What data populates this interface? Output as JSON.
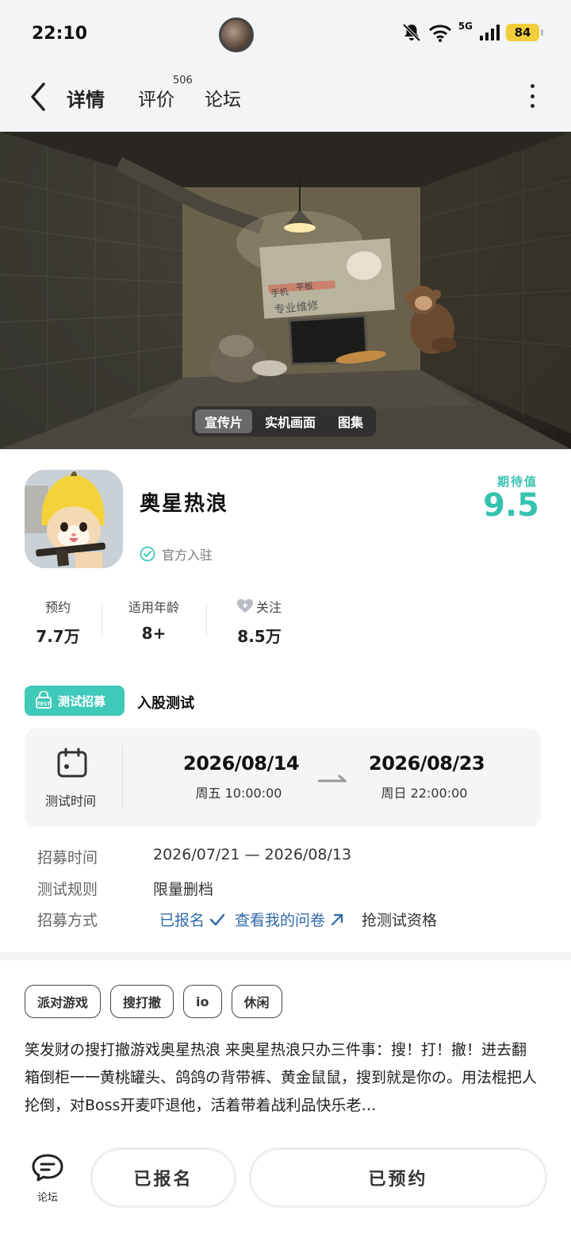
{
  "status": {
    "time": "22:10",
    "network": "5G",
    "wifi_sub": "6",
    "battery": "84"
  },
  "nav": {
    "tabs": [
      {
        "label": "详情"
      },
      {
        "label": "评价",
        "count": "506"
      },
      {
        "label": "论坛"
      }
    ]
  },
  "media": {
    "tabs": [
      "宣传片",
      "实机画面",
      "图集"
    ],
    "poster_text": [
      "手机",
      "平板",
      "专业维修"
    ]
  },
  "app": {
    "name": "奥星热浪",
    "official": "官方入驻",
    "expect_label": "期待值",
    "expect_score": "9.5"
  },
  "stats": [
    {
      "label": "预约",
      "value": "7.7万"
    },
    {
      "label": "适用年龄",
      "value": "8+"
    },
    {
      "label": "关注",
      "value": "8.5万"
    }
  ],
  "recruit": {
    "badge": "测试招募",
    "title": "入股测试",
    "test_time_label": "测试时间",
    "start_date": "2026/08/14",
    "start_sub": "周五  10:00:00",
    "end_date": "2026/08/23",
    "end_sub": "周日  22:00:00",
    "rows": [
      {
        "key": "招募时间",
        "value": "2026/07/21 — 2026/08/13"
      },
      {
        "key": "测试规则",
        "value": "限量删档"
      },
      {
        "key": "招募方式"
      }
    ],
    "signed_up": "已报名",
    "questionnaire": "查看我的问卷",
    "grab": "抢测试资格"
  },
  "tags": [
    "派对游戏",
    "搜打撤",
    "io",
    "休闲"
  ],
  "description": "笑发财の搜打撤游戏奥星热浪 来奥星热浪只办三件事：搜！打！撤！进去翻箱倒柜一一黄桃罐头、鸽鸽の背带裤、黄金鼠鼠，搜到就是你の。用法棍把人抡倒，对Boss开麦吓退他，活着带着战利品快乐老…",
  "bottom": {
    "forum": "论坛",
    "signed_up": "已报名",
    "reserved": "已预约"
  },
  "colors": {
    "accent": "#3ec9b8",
    "link": "#2f6aa8"
  }
}
